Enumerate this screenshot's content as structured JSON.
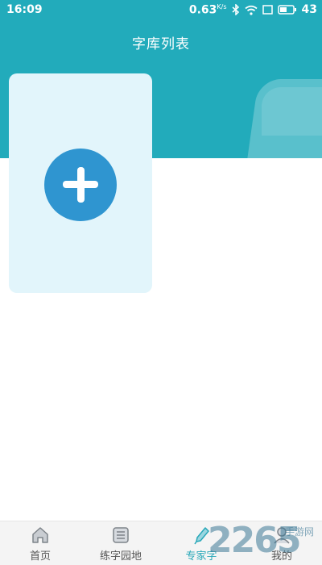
{
  "status_bar": {
    "time": "16:09",
    "speed_value": "0.63",
    "speed_unit": "K/s",
    "battery": "43"
  },
  "header": {
    "title": "字库列表",
    "color": "#22abbb"
  },
  "add_card": {
    "icon": "plus-icon",
    "button_color": "#2f95d0",
    "card_color": "#e2f5fb"
  },
  "tabbar": {
    "items": [
      {
        "label": "首页",
        "icon": "home-icon",
        "active": false
      },
      {
        "label": "练字园地",
        "icon": "list-icon",
        "active": false
      },
      {
        "label": "专家字",
        "icon": "brush-icon",
        "active": true
      },
      {
        "label": "我的",
        "icon": "user-icon",
        "active": false
      }
    ],
    "active_color": "#27a7b8"
  },
  "watermark": {
    "number": "2265",
    "text": "手游网"
  }
}
